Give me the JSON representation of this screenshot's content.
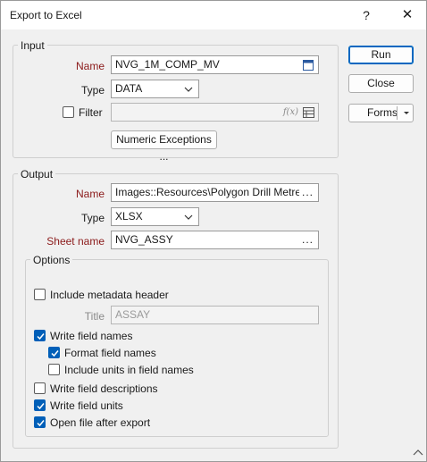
{
  "window": {
    "title": "Export to Excel",
    "help_glyph": "?",
    "close_glyph": "✕"
  },
  "input": {
    "group_label": "Input",
    "name_label": "Name",
    "name_value": "NVG_1M_COMP_MV",
    "type_label": "Type",
    "type_value": "DATA",
    "filter_label": "Filter",
    "filter_checked": false,
    "filter_value": "",
    "filter_fx_glyph": "f(x)",
    "numeric_exceptions_label": "Numeric Exceptions ..."
  },
  "output": {
    "group_label": "Output",
    "name_label": "Name",
    "name_value": "Images::Resources\\Polygon Drill Metres",
    "type_label": "Type",
    "type_value": "XLSX",
    "sheet_label": "Sheet name",
    "sheet_value": "NVG_ASSY",
    "browse_glyph": "..."
  },
  "options": {
    "group_label": "Options",
    "include_metadata": {
      "label": "Include metadata header",
      "checked": false
    },
    "title_label": "Title",
    "title_value": "ASSAY",
    "write_field_names": {
      "label": "Write field names",
      "checked": true
    },
    "format_field_names": {
      "label": "Format field names",
      "checked": true
    },
    "include_units": {
      "label": "Include units in field names",
      "checked": false
    },
    "write_field_descriptions": {
      "label": "Write field descriptions",
      "checked": false
    },
    "write_field_units": {
      "label": "Write field units",
      "checked": true
    },
    "open_after_export": {
      "label": "Open file after export",
      "checked": true
    }
  },
  "buttons": {
    "run": "Run",
    "close": "Close",
    "forms": "Forms"
  },
  "colors": {
    "required_label": "#8b1a1a",
    "accent": "#005fb8",
    "background": "#f0f0f0"
  }
}
